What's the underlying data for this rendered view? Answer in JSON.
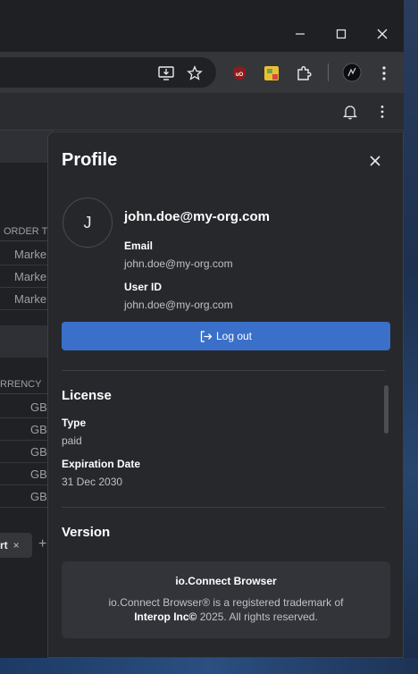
{
  "browser": {
    "window_controls": {
      "minimize": "—",
      "maximize": "☐",
      "close": "✕"
    },
    "extensions": [
      "ublock-origin",
      "sticky-notes",
      "extensions-puzzle",
      "profile-avatar"
    ]
  },
  "background_app": {
    "order_header": "ORDER T",
    "order_rows": [
      "Marke",
      "Marke",
      "Marke"
    ],
    "currency_header": "RRENCY",
    "currency_rows": [
      "GB",
      "GB",
      "GB",
      "GB",
      "GB"
    ],
    "tab_label": "rt",
    "tab_close": "×",
    "add_tab": "+"
  },
  "profile": {
    "title": "Profile",
    "avatar_initial": "J",
    "user_email": "john.doe@my-org.com",
    "email_label": "Email",
    "email_value": "john.doe@my-org.com",
    "user_id_label": "User ID",
    "user_id_value": "john.doe@my-org.com",
    "logout_label": "Log out"
  },
  "license": {
    "title": "License",
    "type_label": "Type",
    "type_value": "paid",
    "expiration_label": "Expiration Date",
    "expiration_value": "31 Dec 2030"
  },
  "version": {
    "title": "Version",
    "product_name": "io.Connect Browser",
    "trademark_line1": "io.Connect Browser® is a registered trademark of",
    "trademark_company": "Interop Inc©",
    "trademark_line2_rest": " 2025. All rights reserved."
  },
  "colors": {
    "accent": "#3a70c9",
    "panel_bg": "#27282c",
    "page_bg": "#202124"
  }
}
